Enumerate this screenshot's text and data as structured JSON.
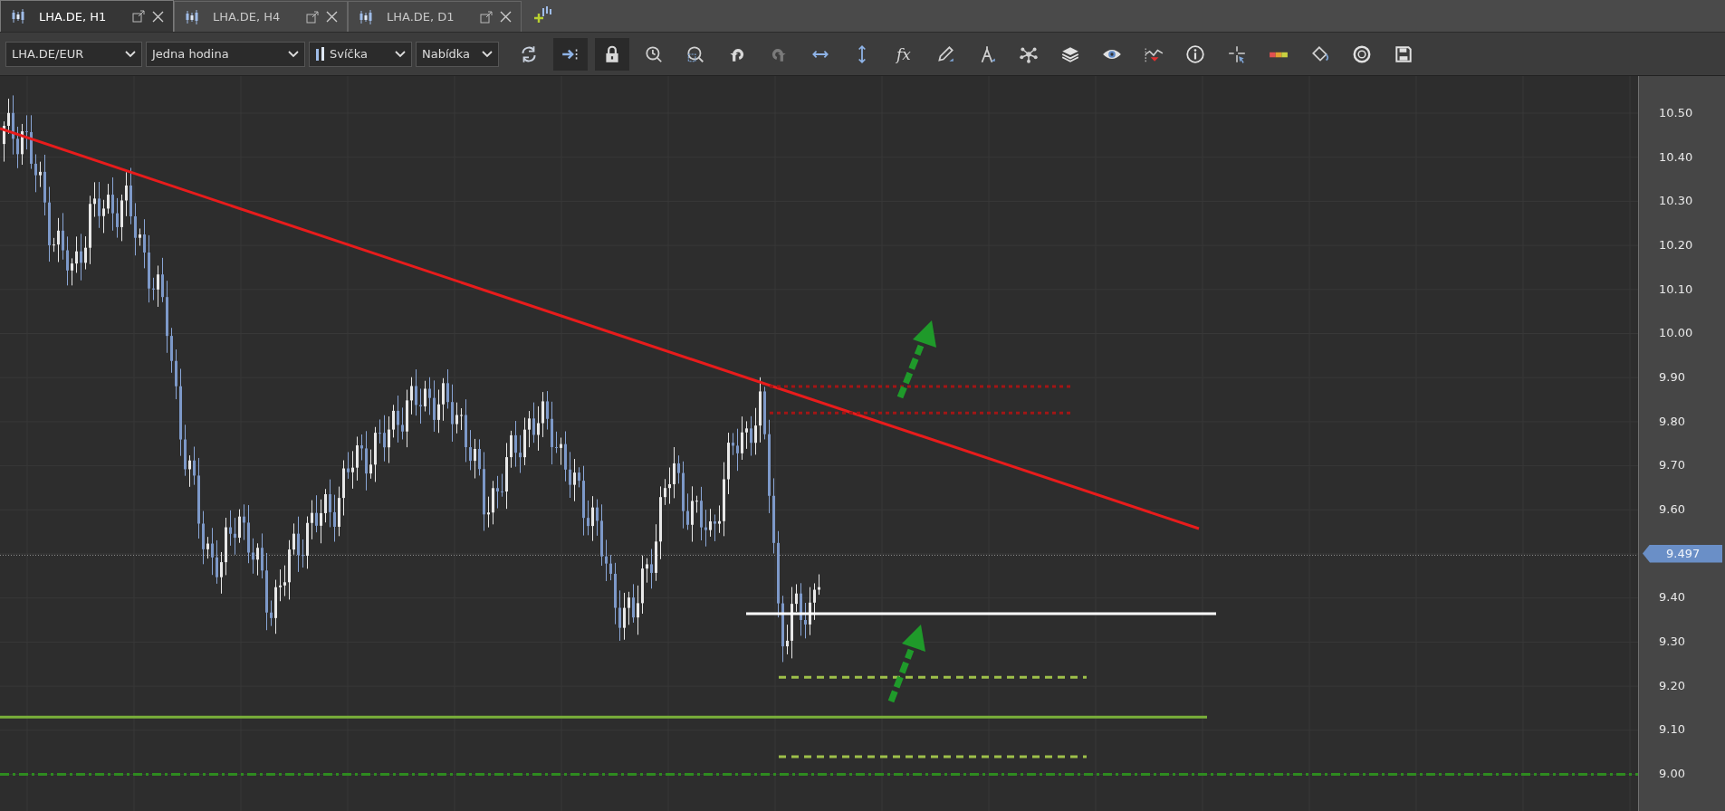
{
  "tabs": [
    {
      "label": "LHA.DE, H1",
      "selected": true
    },
    {
      "label": "LHA.DE, H4",
      "selected": false
    },
    {
      "label": "LHA.DE, D1",
      "selected": false
    }
  ],
  "toolbar": {
    "dropdowns": [
      {
        "kind": "plain",
        "value": "LHA.DE/EUR"
      },
      {
        "kind": "plain",
        "value": "Jedna hodina"
      },
      {
        "kind": "with-icon",
        "value": "Svíčka"
      },
      {
        "kind": "plain",
        "value": "Nabídka"
      }
    ],
    "buttons": [
      {
        "kind": "refresh",
        "pressed": false,
        "disabled": false
      },
      {
        "kind": "shift",
        "pressed": true,
        "disabled": false
      },
      {
        "kind": "lock",
        "pressed": true,
        "disabled": false
      },
      {
        "kind": "zoom-time",
        "pressed": false,
        "disabled": false
      },
      {
        "kind": "zoom-area",
        "pressed": false,
        "disabled": false
      },
      {
        "kind": "undo",
        "pressed": false,
        "disabled": false
      },
      {
        "kind": "redo",
        "pressed": false,
        "disabled": true
      },
      {
        "kind": "fit-width",
        "pressed": false,
        "disabled": false
      },
      {
        "kind": "fit-height",
        "pressed": false,
        "disabled": false
      },
      {
        "kind": "formula",
        "label": "fx",
        "pressed": false,
        "disabled": false
      },
      {
        "kind": "pencil",
        "pressed": false,
        "disabled": false
      },
      {
        "kind": "compass",
        "pressed": false,
        "disabled": false
      },
      {
        "kind": "network",
        "pressed": false,
        "disabled": false
      },
      {
        "kind": "layers",
        "pressed": false,
        "disabled": false
      },
      {
        "kind": "eye",
        "pressed": false,
        "disabled": false
      },
      {
        "kind": "alert",
        "pressed": false,
        "disabled": false
      },
      {
        "kind": "info",
        "pressed": false,
        "disabled": false
      },
      {
        "kind": "crosshair",
        "pressed": false,
        "disabled": false
      },
      {
        "kind": "colorbar",
        "pressed": false,
        "disabled": false
      },
      {
        "kind": "bucket",
        "pressed": false,
        "disabled": false
      },
      {
        "kind": "aperture",
        "pressed": false,
        "disabled": false
      },
      {
        "kind": "save",
        "pressed": false,
        "disabled": false
      }
    ]
  },
  "price_axis": [
    {
      "kind": "tick",
      "label": "10.50"
    },
    {
      "kind": "tick",
      "label": "10.40"
    },
    {
      "kind": "tick",
      "label": "10.30"
    },
    {
      "kind": "tick",
      "label": "10.20"
    },
    {
      "kind": "tick",
      "label": "10.10"
    },
    {
      "kind": "tick",
      "label": "10.00"
    },
    {
      "kind": "tick",
      "label": "9.90"
    },
    {
      "kind": "tick",
      "label": "9.80"
    },
    {
      "kind": "tick",
      "label": "9.70"
    },
    {
      "kind": "tick",
      "label": "9.60"
    },
    {
      "kind": "current",
      "label": "9.497"
    },
    {
      "kind": "tick",
      "label": "9.40"
    },
    {
      "kind": "tick",
      "label": "9.30"
    },
    {
      "kind": "tick",
      "label": "9.20"
    },
    {
      "kind": "tick",
      "label": "9.10"
    },
    {
      "kind": "tick",
      "label": "9.00"
    }
  ]
}
